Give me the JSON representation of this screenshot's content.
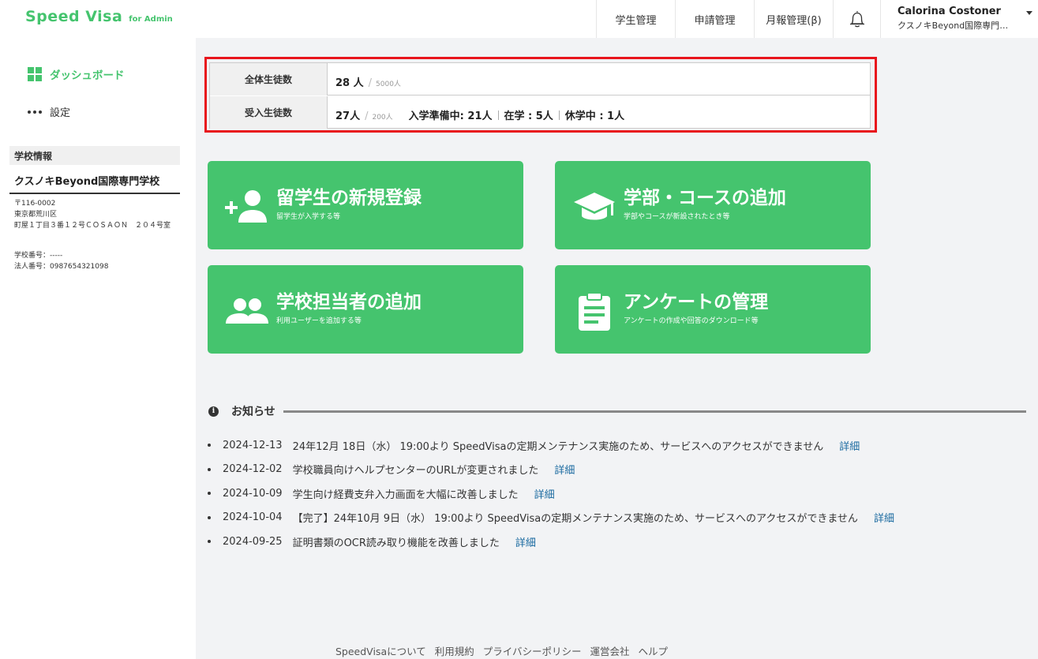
{
  "header": {
    "logo": "Speed Visa",
    "logo_sub": "for Admin",
    "nav": [
      "学生管理",
      "申請管理",
      "月報管理(β)"
    ],
    "user_name": "Calorina Costoner",
    "user_org": "クスノキBeyond国際専門学校"
  },
  "sidebar": {
    "items": [
      {
        "label": "ダッシュボード",
        "icon": "dashboard-grid-icon"
      },
      {
        "label": "設定",
        "icon": "more-dots-icon"
      }
    ],
    "school_heading": "学校情報",
    "school_name": "クスノキBeyond国際専門学校",
    "address_lines": [
      "〒116-0002",
      "東京都荒川区",
      "町屋１丁目３番１２号ＣＯＳＡＯＮ　２０４号室"
    ],
    "school_number": "学校番号：-----",
    "corporate_number": "法人番号：0987654321098"
  },
  "stats": {
    "total_label": "全体生徒数",
    "total_value": "28 人",
    "total_cap": "5000人",
    "accepted_label": "受入生徒数",
    "accepted_value": "27人",
    "accepted_cap": "200人",
    "breakdown": [
      "入学準備中: 21人",
      "在学 : 5人",
      "休学中 : 1人"
    ],
    "highlight_color": "#e8141c"
  },
  "cards": [
    {
      "title": "留学生の新規登録",
      "sub": "留学生が入学する等",
      "icon": "add-person-icon"
    },
    {
      "title": "学部・コースの追加",
      "sub": "学部やコースが新設されたとき等",
      "icon": "graduation-cap-icon"
    },
    {
      "title": "学校担当者の追加",
      "sub": "利用ユーザーを追加する等",
      "icon": "people-group-icon"
    },
    {
      "title": "アンケートの管理",
      "sub": "アンケートの作成や回答のダウンロード等",
      "icon": "clipboard-icon"
    }
  ],
  "accent_color": "#45c46e",
  "news": {
    "title": "お知らせ",
    "link_label": "詳細",
    "items": [
      {
        "date": "2024-12-13",
        "text": "24年12月 18日（水） 19:00より SpeedVisaの定期メンテナンス実施のため、サービスへのアクセスができません"
      },
      {
        "date": "2024-12-02",
        "text": "学校職員向けヘルプセンターのURLが変更されました"
      },
      {
        "date": "2024-10-09",
        "text": "学生向け経費支弁入力画面を大幅に改善しました"
      },
      {
        "date": "2024-10-04",
        "text": "【完了】24年10月 9日（水） 19:00より SpeedVisaの定期メンテナンス実施のため、サービスへのアクセスができません"
      },
      {
        "date": "2024-09-25",
        "text": "証明書類のOCR読み取り機能を改善しました"
      }
    ]
  },
  "footer": [
    "SpeedVisaについて",
    "利用規約",
    "プライバシーポリシー",
    "運営会社",
    "ヘルプ"
  ]
}
